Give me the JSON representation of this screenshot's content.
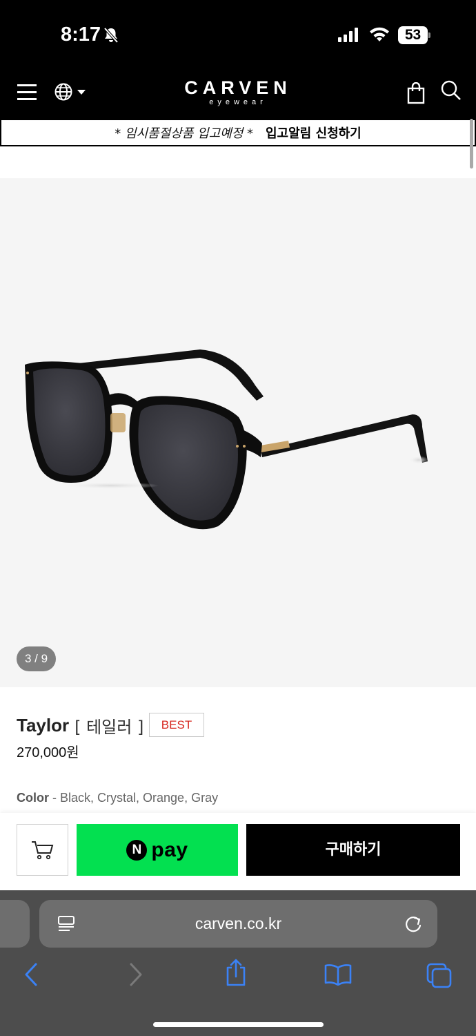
{
  "status_bar": {
    "time": "8:17",
    "battery": "53"
  },
  "header": {
    "logo_main": "CARVEN",
    "logo_sub": "eyewear"
  },
  "notice": {
    "text": "* 임시품절상품 입고예정 *",
    "link": "입고알림 신청하기"
  },
  "gallery": {
    "counter": "3 / 9"
  },
  "product": {
    "name": "Taylor",
    "korean_name": "[ 테일러 ]",
    "badge": "BEST",
    "price": "270,000원",
    "color_label": "Color",
    "color_values": "- Black, Crystal, Orange, Gray"
  },
  "buy_bar": {
    "npay_letter": "N",
    "npay_label": "pay",
    "buy_label": "구매하기"
  },
  "browser": {
    "url": "carven.co.kr"
  },
  "colors": {
    "header_bg": "#000000",
    "npay_green": "#03e050",
    "badge_red": "#d7261e",
    "safari_bg": "#4d4d4d",
    "safari_blue": "#3b82f6"
  }
}
